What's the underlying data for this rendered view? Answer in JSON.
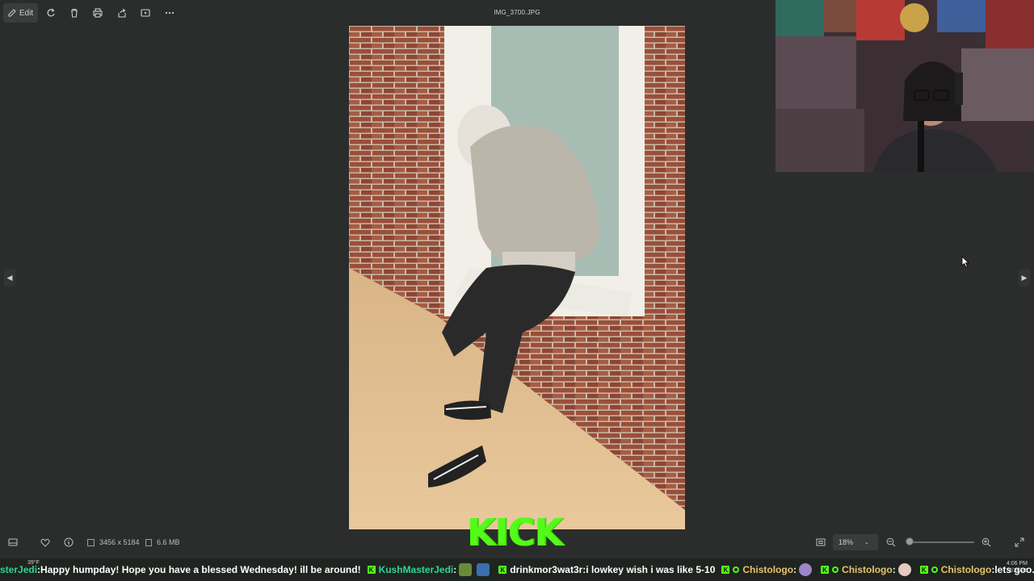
{
  "toolbar": {
    "edit_label": "Edit",
    "icons": [
      "edit-icon",
      "rotate-icon",
      "delete-icon",
      "print-icon",
      "share-icon",
      "slideshow-icon",
      "more-icon"
    ]
  },
  "file_title": "IMG_3700.JPG",
  "status": {
    "dimensions": "3456 x 5184",
    "file_size": "6.6 MB",
    "zoom": "18%"
  },
  "kick_logo_text": "KICK",
  "ticker": {
    "weather": "39°F",
    "messages": [
      {
        "user": "sterJedi",
        "sep": " : ",
        "text": "Happy humpday! Hope you have a blessed Wednesday! ill be around!",
        "color": "#2fd39a"
      },
      {
        "user": "KushMasterJedi",
        "sep": " : ",
        "text": "",
        "color": "#2fd39a"
      },
      {
        "user": "drinkmor3wat3r",
        "sep": " : ",
        "text": "i lowkey wish i was like 5-10",
        "color": "#ffffff"
      },
      {
        "user": "Chistologo",
        "sep": " : ",
        "text": "",
        "color": "#e8c36a"
      },
      {
        "user": "Chistologo",
        "sep": " : ",
        "text": "",
        "color": "#e8c36a"
      },
      {
        "user": "Chistologo",
        "sep": " : ",
        "text": "lets goo...",
        "color": "#e8c36a"
      }
    ],
    "clock_time": "4:06 PM",
    "clock_date": "2/26/25"
  },
  "colors": {
    "background": "#2b2d2c",
    "kick_green": "#53fc18"
  }
}
